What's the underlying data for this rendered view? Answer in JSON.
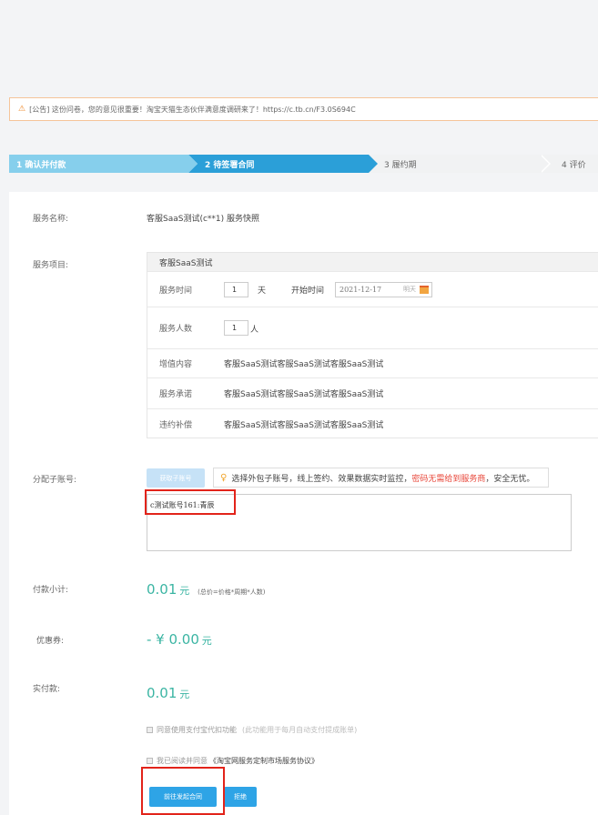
{
  "notice": {
    "icon": "warning-icon",
    "text": "[公告] 这份问卷，您的意见很重要！淘宝天猫生态伙伴满意度调研来了！https://c.tb.cn/F3.0S694C"
  },
  "steps": [
    {
      "label": "1 确认并付款"
    },
    {
      "label": "2 待签署合同"
    },
    {
      "label": "3 履约期"
    },
    {
      "label": "4 评价"
    }
  ],
  "service": {
    "name_label": "服务名称:",
    "name_value": "客服SaaS测试(c**1) 服务快照",
    "items_label": "服务项目:",
    "table_title": "客服SaaS测试",
    "time_label": "服务时间",
    "time_value": "1",
    "time_unit": "天",
    "start_label": "开始时间",
    "start_date": "2021-12-17",
    "tomorrow": "明天",
    "people_label": "服务人数",
    "people_value": "1",
    "people_unit": "人",
    "added_label": "增值内容",
    "added_value": "客服SaaS测试客服SaaS测试客服SaaS测试",
    "promise_label": "服务承诺",
    "promise_value": "客服SaaS测试客服SaaS测试客服SaaS测试",
    "penalty_label": "违约补偿",
    "penalty_value": "客服SaaS测试客服SaaS测试客服SaaS测试"
  },
  "subaccount": {
    "label": "分配子账号:",
    "button": "获取子账号",
    "tip_prefix": "选择外包子账号，线上签约、效果数据实时监控，",
    "tip_red": "密码无需给到服务商",
    "tip_suffix": "，安全无忧。",
    "entry": "c测试账号161:青辰"
  },
  "payment": {
    "subtotal_label": "付款小计:",
    "subtotal_value": "0.01",
    "unit": "元",
    "subtotal_note": "(总价=价格*周期*人数)",
    "coupon_label": "优惠券:",
    "coupon_value": "- ¥ 0.00",
    "actual_label": "实付款:",
    "actual_value": "0.01"
  },
  "agreements": {
    "alipay_label": "同意使用支付宝代扣功能",
    "alipay_note": "(此功能用于每月自动支付提成账单)",
    "read_label": "我已阅读并同意",
    "read_link": "《淘宝网服务定制市场服务协议》"
  },
  "actions": {
    "primary": "前往发起合同",
    "reject": "拒绝"
  },
  "colors": {
    "accent": "#2ea4e6",
    "step_done": "#86cfec",
    "step_active": "#2b9fd8",
    "amount": "#3bb5a3",
    "highlight_box": "#e2231a"
  }
}
